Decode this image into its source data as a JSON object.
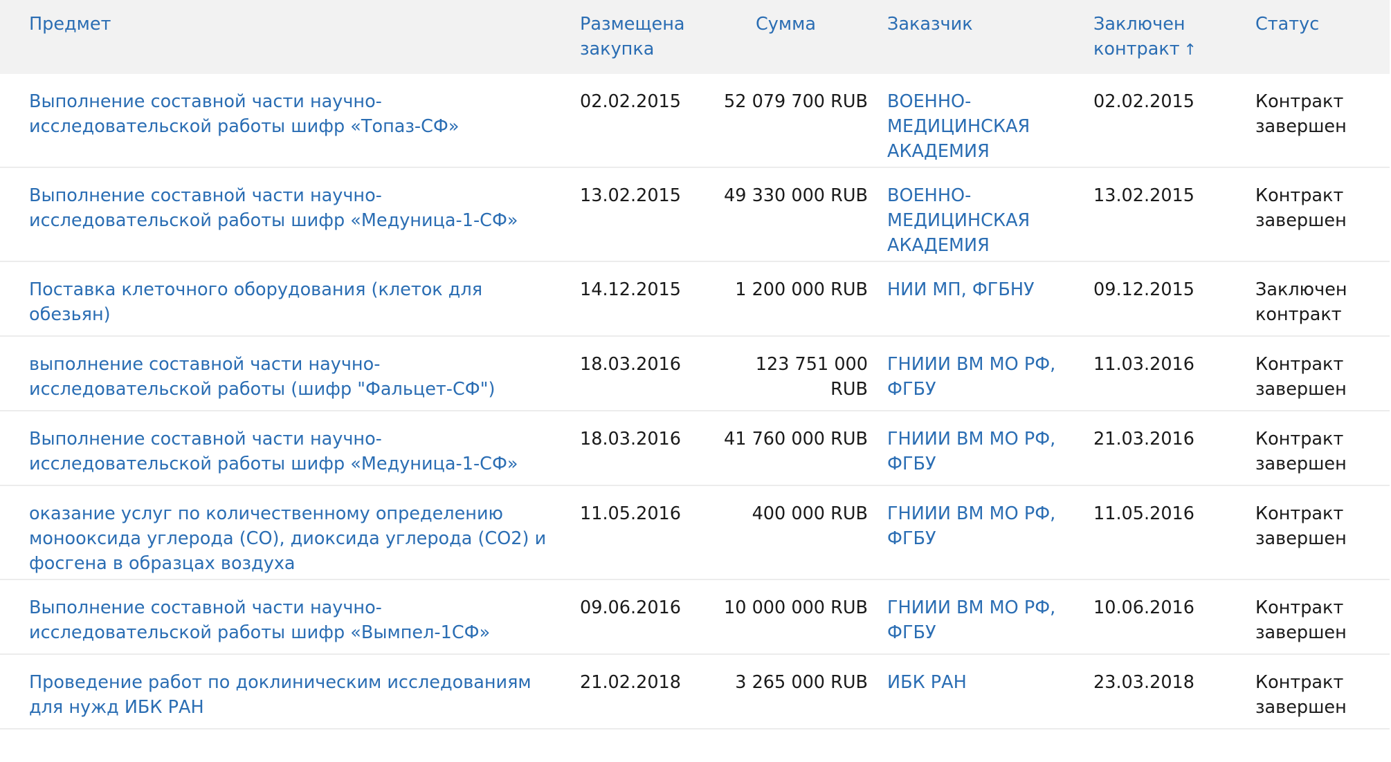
{
  "columns": {
    "subject": "Предмет",
    "placed": "Размещена закупка",
    "sum": "Сумма",
    "customer": "Заказчик",
    "closed": "Заключен контракт",
    "status": "Статус"
  },
  "sort_indicator": "↑",
  "rows": [
    {
      "subject": "Выполнение составной части научно-исследовательской работы шифр «Топаз-СФ»",
      "placed": "02.02.2015",
      "sum": "52 079 700 RUB",
      "customer": "ВОЕННО-МЕДИЦИНСКАЯ АКАДЕМИЯ",
      "closed": "02.02.2015",
      "status": "Контракт завершен"
    },
    {
      "subject": "Выполнение составной части научно-исследовательской работы шифр «Медуница-1-СФ»",
      "placed": "13.02.2015",
      "sum": "49 330 000 RUB",
      "customer": "ВОЕННО-МЕДИЦИНСКАЯ АКАДЕМИЯ",
      "closed": "13.02.2015",
      "status": "Контракт завершен"
    },
    {
      "subject": "Поставка клеточного оборудования (клеток для обезьян)",
      "placed": "14.12.2015",
      "sum": "1 200 000 RUB",
      "customer": "НИИ МП, ФГБНУ",
      "closed": "09.12.2015",
      "status": "Заключен контракт"
    },
    {
      "subject": "выполнение составной части научно-исследовательской работы (шифр \"Фальцет-СФ\")",
      "placed": "18.03.2016",
      "sum": "123 751 000 RUB",
      "customer": "ГНИИИ ВМ МО РФ, ФГБУ",
      "closed": "11.03.2016",
      "status": "Контракт завершен"
    },
    {
      "subject": "Выполнение составной части научно-исследовательской работы шифр «Медуница-1-СФ»",
      "placed": "18.03.2016",
      "sum": "41 760 000 RUB",
      "customer": "ГНИИИ ВМ МО РФ, ФГБУ",
      "closed": "21.03.2016",
      "status": "Контракт завершен"
    },
    {
      "subject": "оказание услуг по количественному определению монооксида углерода (СО), диоксида углерода (СО2) и фосгена в образцах воздуха",
      "placed": "11.05.2016",
      "sum": "400 000 RUB",
      "customer": "ГНИИИ ВМ МО РФ, ФГБУ",
      "closed": "11.05.2016",
      "status": "Контракт завершен"
    },
    {
      "subject": "Выполнение составной части научно-исследовательской работы шифр «Вымпел-1СФ»",
      "placed": "09.06.2016",
      "sum": "10 000 000 RUB",
      "customer": "ГНИИИ ВМ МО РФ, ФГБУ",
      "closed": "10.06.2016",
      "status": "Контракт завершен"
    },
    {
      "subject": "Проведение работ по доклиническим исследованиям для нужд ИБК РАН",
      "placed": "21.02.2018",
      "sum": "3 265 000 RUB",
      "customer": "ИБК РАН",
      "closed": "23.03.2018",
      "status": "Контракт завершен"
    }
  ],
  "colors": {
    "link": "#2a6db3",
    "header_bg": "#f2f2f2",
    "divider": "#ececec"
  }
}
